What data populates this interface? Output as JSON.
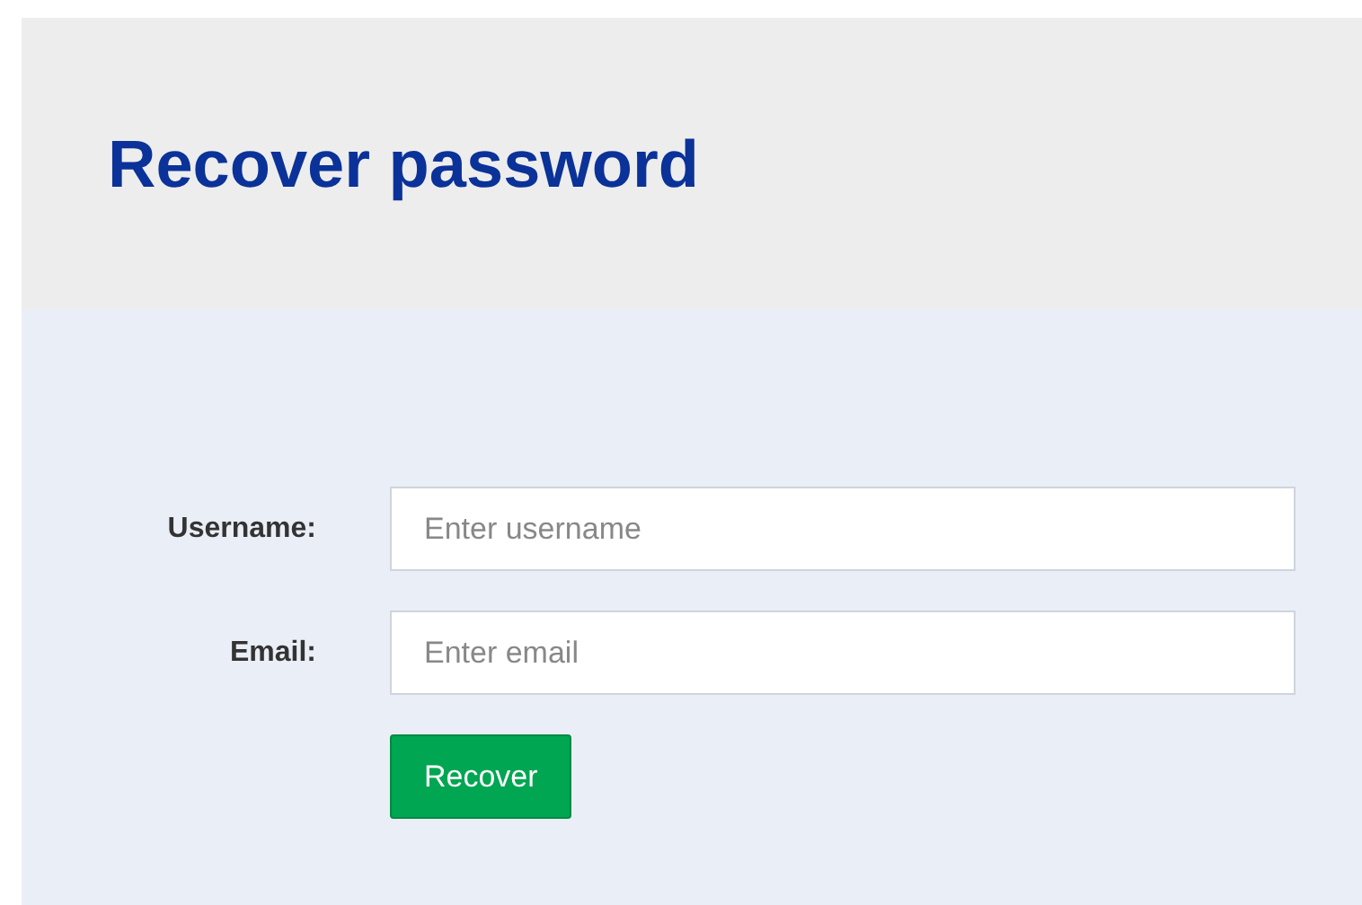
{
  "title": "Recover password",
  "fields": [
    {
      "label": "Username:",
      "placeholder": "Enter username"
    },
    {
      "label": "Email:",
      "placeholder": "Enter email"
    }
  ],
  "button": "Recover"
}
